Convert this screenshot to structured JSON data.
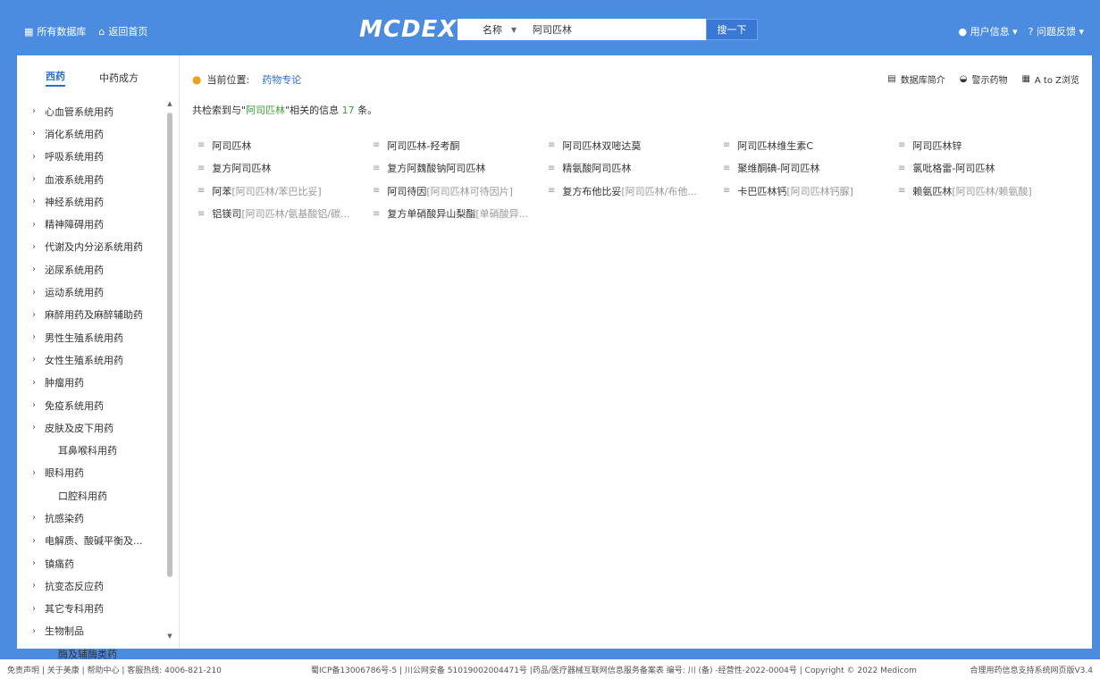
{
  "topbar": {
    "all_db": "所有数据库",
    "home": "返回首页",
    "logo": "MCDEX",
    "search_category": "名称",
    "search_query": "阿司匹林",
    "search_button": "搜一下",
    "user_info": "用户信息",
    "feedback": "问题反馈"
  },
  "sidebar": {
    "tab_western": "西药",
    "tab_chinese": "中药成方",
    "items": [
      {
        "label": "心血管系统用药",
        "chev": true
      },
      {
        "label": "消化系统用药",
        "chev": true
      },
      {
        "label": "呼吸系统用药",
        "chev": true
      },
      {
        "label": "血液系统用药",
        "chev": true
      },
      {
        "label": "神经系统用药",
        "chev": true
      },
      {
        "label": "精神障碍用药",
        "chev": true
      },
      {
        "label": "代谢及内分泌系统用药",
        "chev": true
      },
      {
        "label": "泌尿系统用药",
        "chev": true
      },
      {
        "label": "运动系统用药",
        "chev": true
      },
      {
        "label": "麻醉用药及麻醉辅助药",
        "chev": true
      },
      {
        "label": "男性生殖系统用药",
        "chev": true
      },
      {
        "label": "女性生殖系统用药",
        "chev": true
      },
      {
        "label": "肿瘤用药",
        "chev": true
      },
      {
        "label": "免疫系统用药",
        "chev": true
      },
      {
        "label": "皮肤及皮下用药",
        "chev": true
      },
      {
        "label": "耳鼻喉科用药",
        "chev": false
      },
      {
        "label": "眼科用药",
        "chev": true
      },
      {
        "label": "口腔科用药",
        "chev": false
      },
      {
        "label": "抗感染药",
        "chev": true
      },
      {
        "label": "电解质、酸碱平衡及...",
        "chev": true
      },
      {
        "label": "镇痛药",
        "chev": true
      },
      {
        "label": "抗变态反应药",
        "chev": true
      },
      {
        "label": "其它专科用药",
        "chev": true
      },
      {
        "label": "生物制品",
        "chev": true
      },
      {
        "label": "酶及辅酶类药",
        "chev": false
      }
    ]
  },
  "main": {
    "location_label": "当前位置:",
    "location_value": "药物专论",
    "tools": [
      "数据库简介",
      "警示药物",
      "A to Z浏览"
    ],
    "count_prefix": "共检索到与\"",
    "count_term": "阿司匹林",
    "count_mid": "\"相关的信息",
    "count_num": "17",
    "count_suffix": "条。",
    "results": [
      [
        {
          "name": "阿司匹林",
          "alt": ""
        },
        {
          "name": "阿司匹林-羟考酮",
          "alt": ""
        },
        {
          "name": "阿司匹林双嘧达莫",
          "alt": ""
        },
        {
          "name": "阿司匹林维生素C",
          "alt": ""
        },
        {
          "name": "阿司匹林锌",
          "alt": ""
        }
      ],
      [
        {
          "name": "复方阿司匹林",
          "alt": ""
        },
        {
          "name": "复方阿魏酸钠阿司匹林",
          "alt": ""
        },
        {
          "name": "精氨酸阿司匹林",
          "alt": ""
        },
        {
          "name": "聚维酮碘-阿司匹林",
          "alt": ""
        },
        {
          "name": "氯吡格雷-阿司匹林",
          "alt": ""
        }
      ],
      [
        {
          "name": "阿苯",
          "alt": "[阿司匹林/苯巴比妥]"
        },
        {
          "name": "阿司待因",
          "alt": "[阿司匹林可待因片]"
        },
        {
          "name": "复方布他比妥",
          "alt": "[阿司匹林/布他..."
        },
        {
          "name": "卡巴匹林钙",
          "alt": "[阿司匹林钙脲]"
        },
        {
          "name": "赖氨匹林",
          "alt": "[阿司匹林/赖氨酸]"
        }
      ],
      [
        {
          "name": "铝镁司",
          "alt": "[阿司匹林/氨基酸铝/碳..."
        },
        {
          "name": "复方单硝酸异山梨酯",
          "alt": "[单硝酸异..."
        }
      ]
    ]
  },
  "footer": {
    "left": "免责声明  |  关于美康  |  帮助中心  |  客服热线: 4006-821-210",
    "middle": "蜀ICP备13006786号-5  |  川公网安备 51019002004471号  |药品/医疗器械互联网信息服务备案表 编号: 川 (备) -经营性-2022-0004号 | Copyright © 2022 Medicom",
    "right": "合理用药信息支持系统网页版V3.4"
  }
}
